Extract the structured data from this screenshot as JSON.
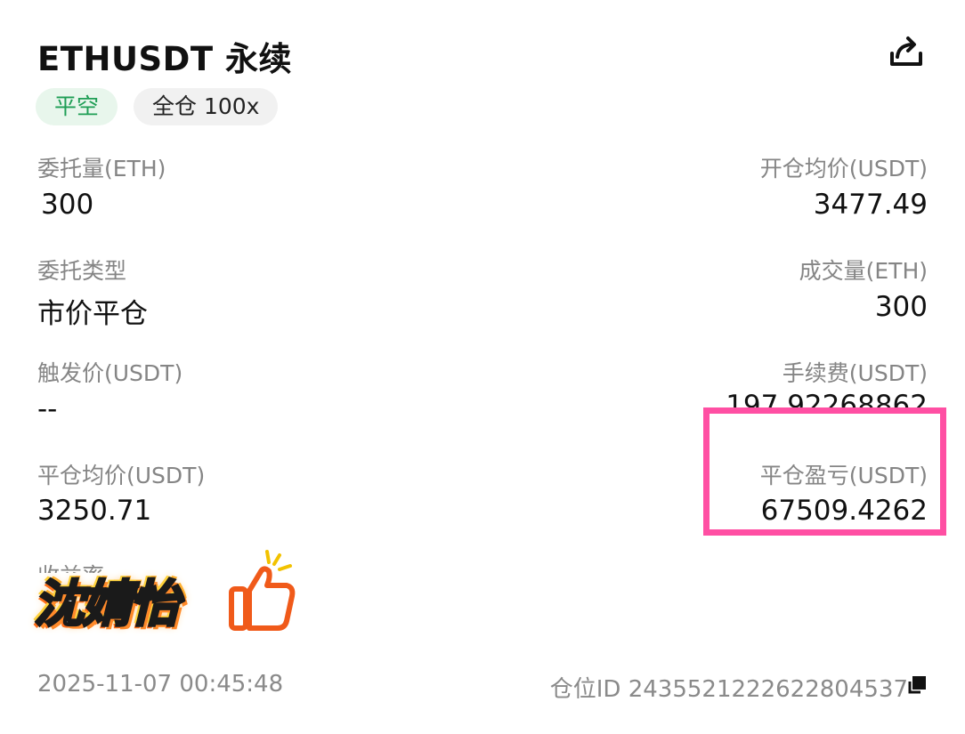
{
  "header": {
    "title": "ETHUSDT 永续",
    "share_icon": "share-icon"
  },
  "tags": {
    "side": "平空",
    "margin": "全仓 100x"
  },
  "fields": {
    "order_qty_label": "委托量(ETH)",
    "order_qty_value": "300",
    "open_avg_label": "开仓均价(USDT)",
    "open_avg_value": "3477.49",
    "order_type_label": "委托类型",
    "order_type_value": "市价平仓",
    "filled_qty_label": "成交量(ETH)",
    "filled_qty_value": "300",
    "trigger_label": "触发价(USDT)",
    "trigger_value": "--",
    "fee_label": "手续费(USDT)",
    "fee_value": "197.92268862",
    "close_avg_label": "平仓均价(USDT)",
    "close_avg_value": "3250.71",
    "close_pnl_label": "平仓盈亏(USDT)",
    "close_pnl_value": "67509.4262",
    "partial_label": "收益率"
  },
  "sticker": {
    "text": "沈婧怡",
    "icon": "thumbs-up-icon"
  },
  "footer": {
    "time": "2025-11-07 00:45:48",
    "position_id": "仓位ID 2435521222622804537",
    "copy_icon": "copy-icon"
  },
  "colors": {
    "green": "#1e9e55",
    "highlight": "#ff4fa3",
    "label_gray": "#858585"
  }
}
